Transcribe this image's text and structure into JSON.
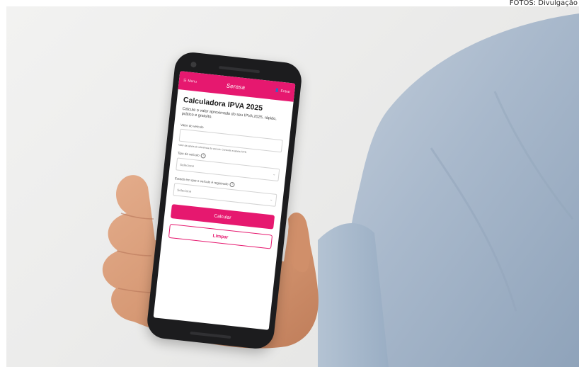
{
  "photo_credit": "FOTOS: Divulgação",
  "app": {
    "header": {
      "left_label": "Menu",
      "logo": "Serasa",
      "right_label": "Entrar"
    },
    "title": "Calculadora IPVA 2025",
    "description": "Calcule o valor aproximado do seu IPVA 2025, rápido, prático e gratuito.",
    "fields": [
      {
        "label": "Valor do veículo",
        "value": ""
      },
      {
        "label": "Tipo de veículo",
        "placeholder": "Selecione"
      },
      {
        "label": "Estado em que o veículo é registrado",
        "placeholder": "Selecione"
      }
    ],
    "hint": "Valor da tabela de referência do veículo. Consulte a tabela FIPE.",
    "calculate_button": "Calcular",
    "clear_button": "Limpar"
  },
  "colors": {
    "brand": "#e6186f",
    "background": "#ededec",
    "shirt": "#a9b9cc",
    "skin": "#d79b78"
  }
}
